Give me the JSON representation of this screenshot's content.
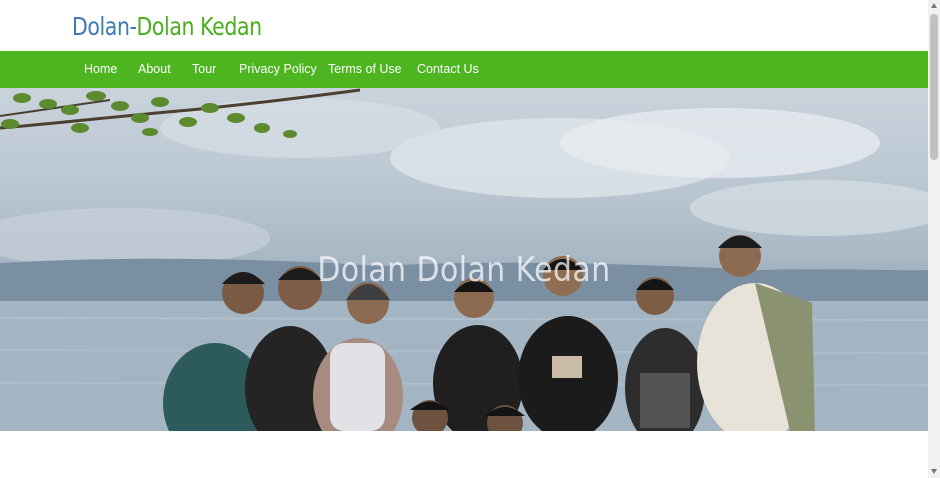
{
  "site": {
    "logo_part1": "Dolan-",
    "logo_part2": "Dolan Kedan"
  },
  "nav": {
    "items": [
      {
        "label": "Home"
      },
      {
        "label": "About"
      },
      {
        "label": "Tour"
      },
      {
        "label": "Privacy Policy"
      },
      {
        "label": "Terms of Use"
      },
      {
        "label": "Contact Us"
      }
    ]
  },
  "hero": {
    "title": "Dolan Dolan Kedan"
  },
  "colors": {
    "logo_blue": "#3d7ab5",
    "logo_green": "#4cae1e",
    "nav_green": "#4db51f"
  }
}
